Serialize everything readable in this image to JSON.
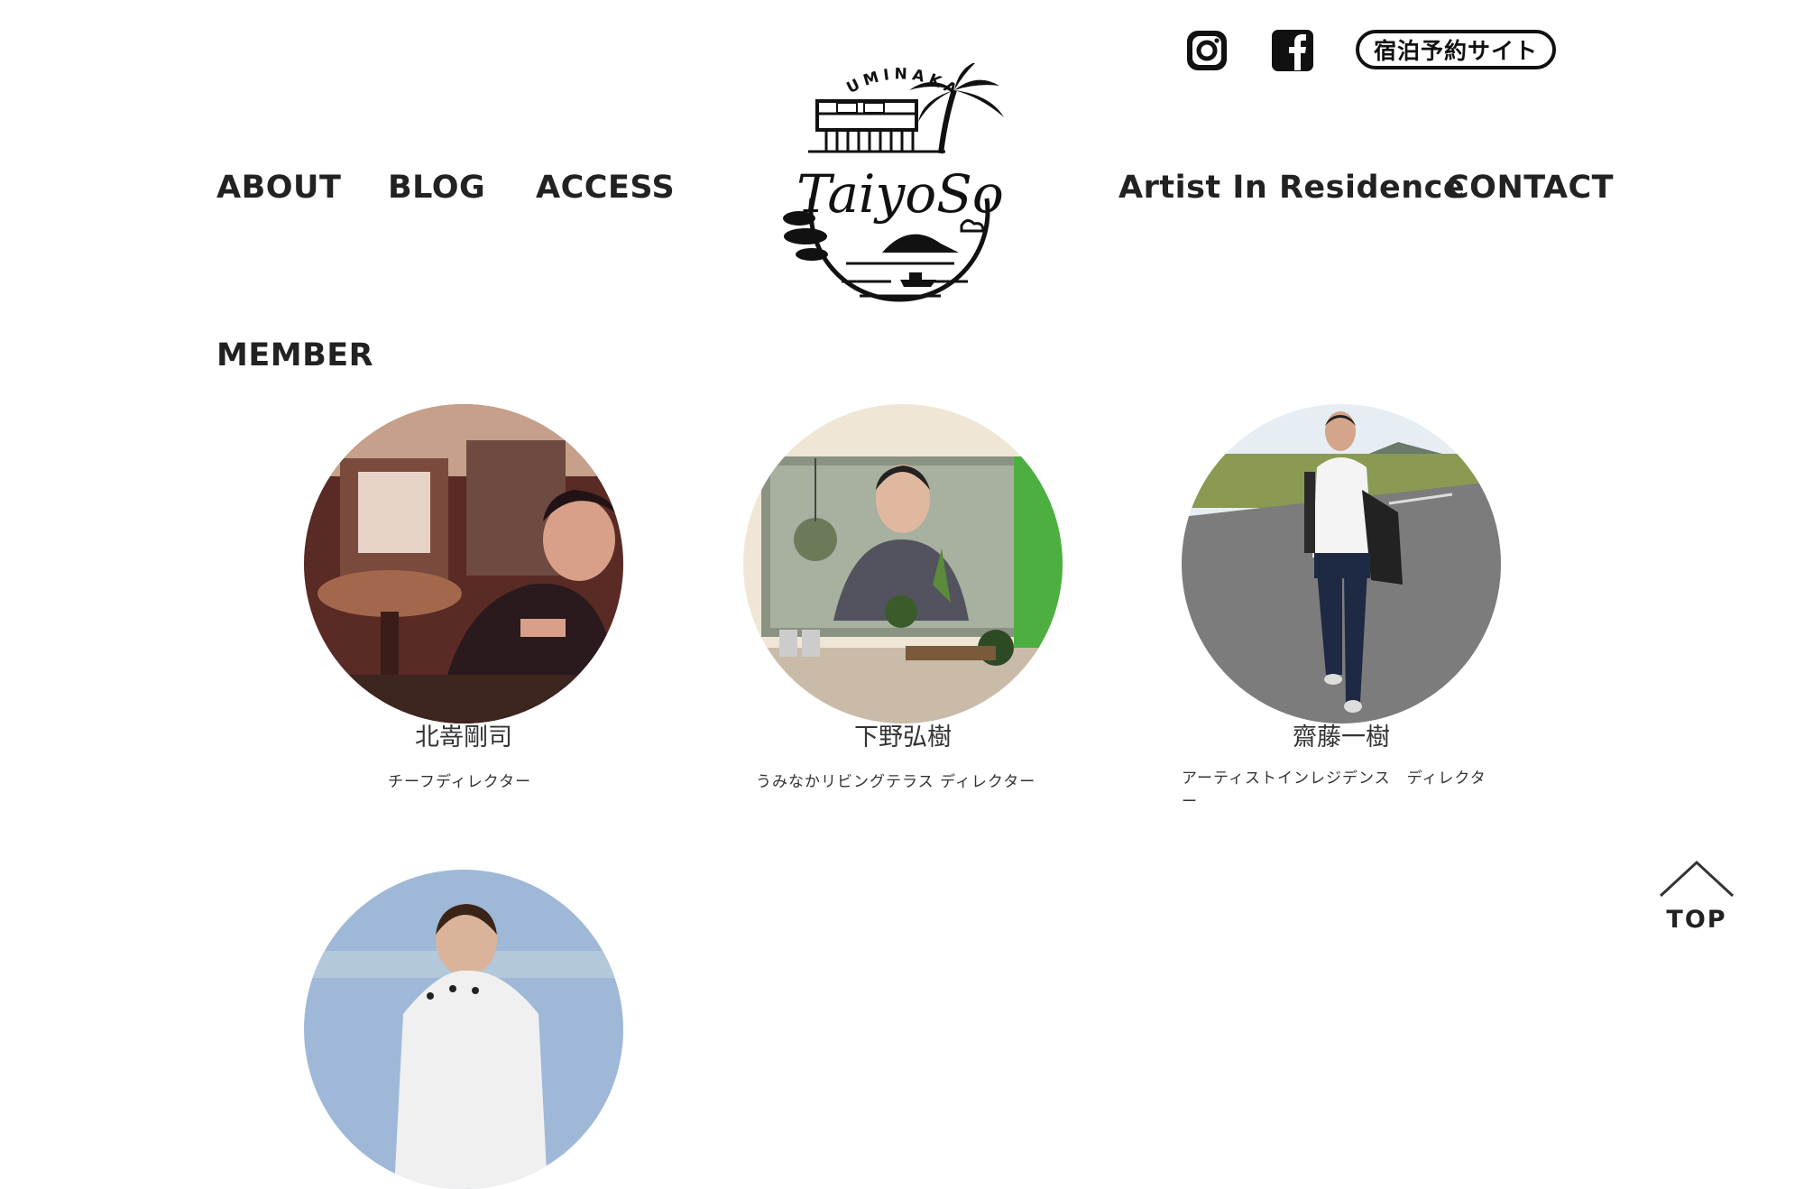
{
  "header": {
    "social": [
      "instagram-icon",
      "facebook-icon"
    ],
    "booking_label": "宿泊予約サイト",
    "logo_text_top": "UMINAKA",
    "logo_text_main": "TaiyoSo"
  },
  "nav": {
    "about": "ABOUT",
    "blog": "BLOG",
    "access": "ACCESS",
    "air": "Artist In Residence",
    "contact": "CONTACT"
  },
  "section": {
    "title": "MEMBER"
  },
  "members": [
    {
      "name": "北嵜剛司",
      "role": "チーフディレクター"
    },
    {
      "name": "下野弘樹",
      "role": "うみなかリビングテラス ディレクター"
    },
    {
      "name": "齋藤一樹",
      "role": "アーティストインレジデンス　ディレクター"
    }
  ],
  "top_button": {
    "label": "TOP"
  },
  "colors": {
    "text": "#222222",
    "background": "#ffffff",
    "accent": "#111111"
  }
}
